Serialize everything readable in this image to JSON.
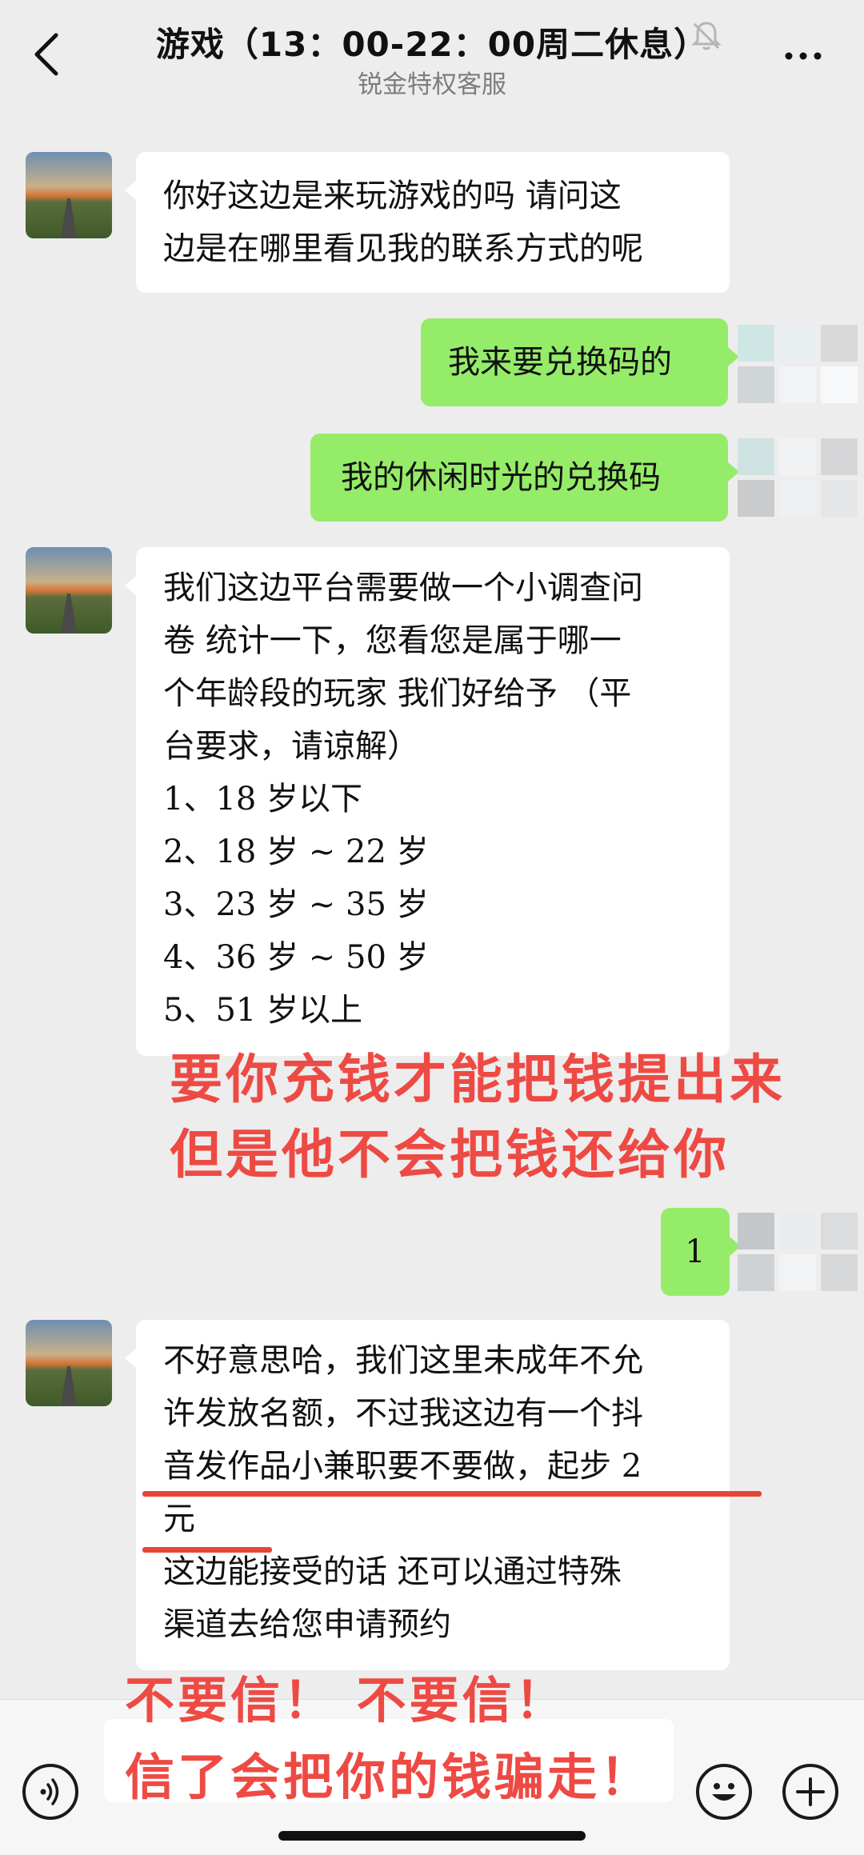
{
  "header": {
    "title": "游戏（13：00-22：00周二休息）",
    "subtitle": "锐金特权客服"
  },
  "messages": [
    {
      "from": "them",
      "lines": [
        "你好这边是来玩游戏的吗 请问这",
        "边是在哪里看见我的联系方式的呢"
      ]
    },
    {
      "from": "me",
      "text": "我来要兑换码的"
    },
    {
      "from": "me",
      "text": "我的休闲时光的兑换码"
    },
    {
      "from": "them",
      "lines": [
        "我们这边平台需要做一个小调查问",
        "卷 统计一下，您看您是属于哪一",
        "个年龄段的玩家 我们好给予 （平",
        "台要求，请谅解）",
        "1、18 岁以下",
        "2、18 岁 ~ 22 岁",
        "3、23 岁 ~ 35 岁",
        "4、36 岁 ~ 50 岁",
        "5、51 岁以上"
      ]
    },
    {
      "from": "me",
      "text": "1"
    },
    {
      "from": "them",
      "lines": [
        "不好意思哈，我们这里未成年不允",
        "许发放名额，不过我这边有一个抖",
        "音发作品小兼职要不要做，起步 2",
        "元",
        "这边能接受的话 还可以通过特殊",
        "渠道去给您申请预约"
      ]
    }
  ],
  "annotations": {
    "warning1": [
      "要你充钱才能把钱提出来",
      "但是他不会把钱还给你"
    ],
    "warning2": [
      "不要信！ 不要信！",
      "信了会把你的钱骗走！"
    ]
  },
  "colors": {
    "background": "#ededed",
    "outgoing_bubble": "#95ec69",
    "incoming_bubble": "#ffffff",
    "annotation": "#ee4a44"
  },
  "icons": [
    "back-arrow-icon",
    "muted-bell-icon",
    "more-icon",
    "voice-icon",
    "emoji-icon",
    "plus-icon"
  ]
}
